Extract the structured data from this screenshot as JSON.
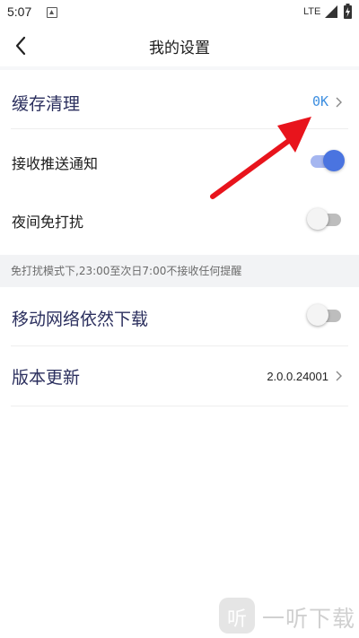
{
  "status_bar": {
    "time": "5:07",
    "network": "LTE",
    "notification_icon": "notification-a-icon",
    "signal_icon": "signal-icon",
    "battery_icon": "battery-charging-icon"
  },
  "header": {
    "title": "我的设置",
    "back_icon": "chevron-left-icon"
  },
  "settings": {
    "cache": {
      "label": "缓存清理",
      "value": "0K"
    },
    "push": {
      "label": "接收推送通知",
      "enabled": true
    },
    "night": {
      "label": "夜间免打扰",
      "enabled": false
    },
    "note": "免打扰模式下,23:00至次日7:00不接收任何提醒",
    "mobile_download": {
      "label": "移动网络依然下载",
      "enabled": false
    },
    "version": {
      "label": "版本更新",
      "value": "2.0.0.24001"
    }
  },
  "annotation": {
    "arrow_color": "#e8141c"
  },
  "watermark": {
    "logo_glyph": "听",
    "text": "一听下载"
  },
  "colors": {
    "accent": "#4a74e0",
    "label": "#2b2f5e",
    "value": "#3e8fe0"
  }
}
